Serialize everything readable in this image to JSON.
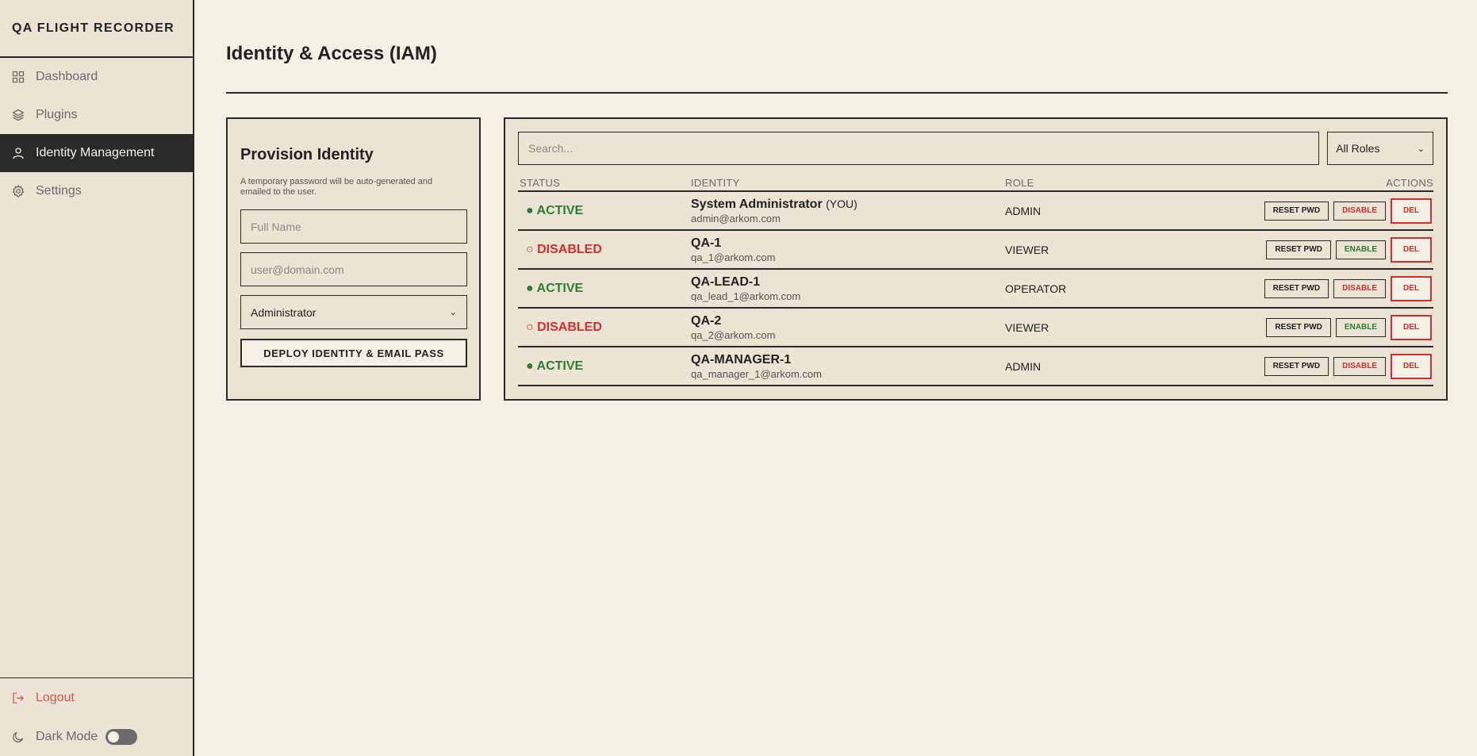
{
  "app": {
    "title": "QA FLIGHT RECORDER"
  },
  "sidebar": {
    "items": [
      {
        "label": "Dashboard",
        "icon": "grid-icon"
      },
      {
        "label": "Plugins",
        "icon": "layers-icon"
      },
      {
        "label": "Identity Management",
        "icon": "user-icon",
        "active": true
      },
      {
        "label": "Settings",
        "icon": "gear-icon"
      }
    ],
    "logout_label": "Logout",
    "dark_mode_label": "Dark Mode",
    "dark_mode_on": false
  },
  "page": {
    "title": "Identity & Access (IAM)"
  },
  "provision": {
    "title": "Provision Identity",
    "hint": "A temporary password will be auto-generated and emailed to the user.",
    "name_placeholder": "Full Name",
    "email_placeholder": "user@domain.com",
    "role_value": "Administrator",
    "submit_label": "DEPLOY IDENTITY & EMAIL PASS"
  },
  "users": {
    "search_placeholder": "Search...",
    "role_filter": "All Roles",
    "columns": {
      "status": "STATUS",
      "identity": "IDENTITY",
      "role": "ROLE",
      "actions": "ACTIONS"
    },
    "you_tag": "(YOU)",
    "actions": {
      "reset": "RESET PWD",
      "disable": "DISABLE",
      "enable": "ENABLE",
      "delete": "DEL"
    },
    "rows": [
      {
        "status": "● ACTIVE",
        "name": "System Administrator",
        "you": true,
        "email": "admin@arkom.com",
        "role": "ADMIN",
        "toggle": "DISABLE"
      },
      {
        "status": "○ DISABLED",
        "name": "QA-1",
        "you": false,
        "email": "qa_1@arkom.com",
        "role": "VIEWER",
        "toggle": "ENABLE"
      },
      {
        "status": "● ACTIVE",
        "name": "QA-LEAD-1",
        "you": false,
        "email": "qa_lead_1@arkom.com",
        "role": "OPERATOR",
        "toggle": "DISABLE"
      },
      {
        "status": "○ DISABLED",
        "name": "QA-2",
        "you": false,
        "email": "qa_2@arkom.com",
        "role": "VIEWER",
        "toggle": "ENABLE"
      },
      {
        "status": "● ACTIVE",
        "name": "QA-MANAGER-1",
        "you": false,
        "email": "qa_manager_1@arkom.com",
        "role": "ADMIN",
        "toggle": "DISABLE"
      }
    ]
  },
  "colors": {
    "active": "#2e7d32",
    "disabled": "#d32f2f",
    "ink": "#2a2a2a",
    "paper": "#f4f0e5"
  }
}
